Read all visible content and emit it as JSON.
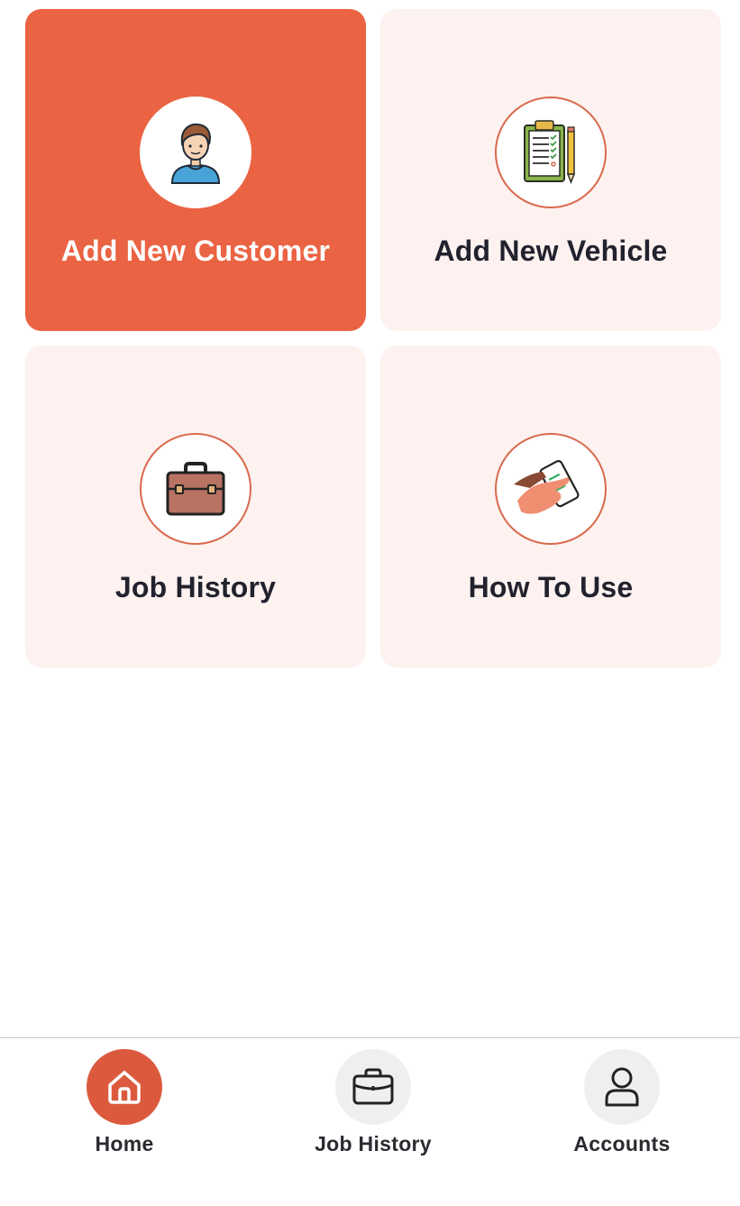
{
  "cards": [
    {
      "label": "Add New Customer",
      "icon": "customer-avatar-icon",
      "active": true
    },
    {
      "label": "Add New Vehicle",
      "icon": "clipboard-checklist-icon",
      "active": false
    },
    {
      "label": "Job History",
      "icon": "briefcase-icon",
      "active": false
    },
    {
      "label": "How To Use",
      "icon": "hand-phone-icon",
      "active": false
    }
  ],
  "bottom_nav": {
    "items": [
      {
        "label": "Home",
        "icon": "home-icon",
        "active": true
      },
      {
        "label": "Job History",
        "icon": "briefcase-icon",
        "active": false
      },
      {
        "label": "Accounts",
        "icon": "user-icon",
        "active": false
      }
    ]
  },
  "colors": {
    "accent": "#ea6342",
    "card_background": "#fdf2f0",
    "text_dark": "#22222e",
    "nav_inactive": "#efefef"
  }
}
